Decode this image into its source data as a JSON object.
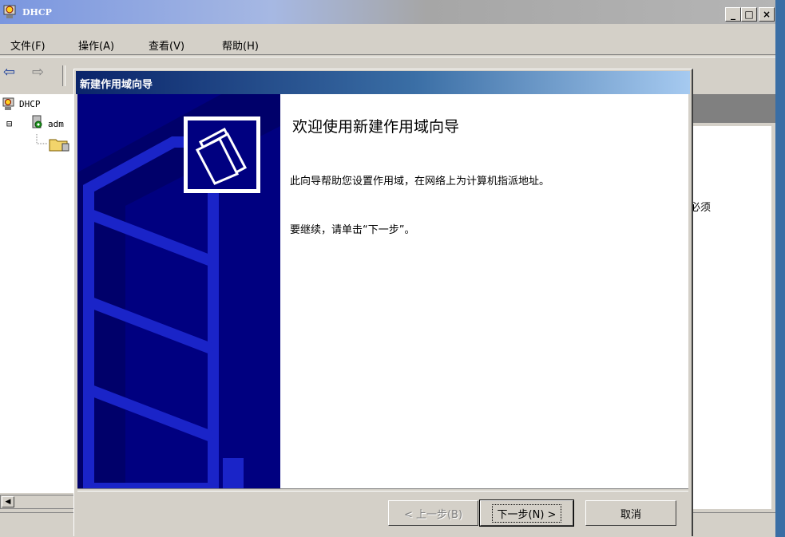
{
  "window": {
    "title": "DHCP"
  },
  "window_controls": {
    "minimize": "_",
    "maximize": "□",
    "close": "×"
  },
  "menu": {
    "file": "文件(F)",
    "action": "操作(A)",
    "view": "查看(V)",
    "help": "帮助(H)"
  },
  "toolbar": {
    "back": "⇦",
    "forward": "⇨"
  },
  "tree": {
    "root": "DHCP",
    "server": "adm",
    "expander": "⊟"
  },
  "right_pane": {
    "partial_text": "必须"
  },
  "wizard": {
    "title": "新建作用域向导",
    "heading": "欢迎使用新建作用域向导",
    "description": "此向导帮助您设置作用域，在网络上为计算机指派地址。",
    "continue_text": "要继续，请单击“下一步”。",
    "back_button": "< 上一步(B)",
    "next_button": "下一步(N) >",
    "cancel_button": "取消"
  },
  "colors": {
    "desktop": "#3a6ea5",
    "chrome": "#d4d0c8",
    "dialog_title": "#0a246a",
    "banner": "#000080"
  }
}
